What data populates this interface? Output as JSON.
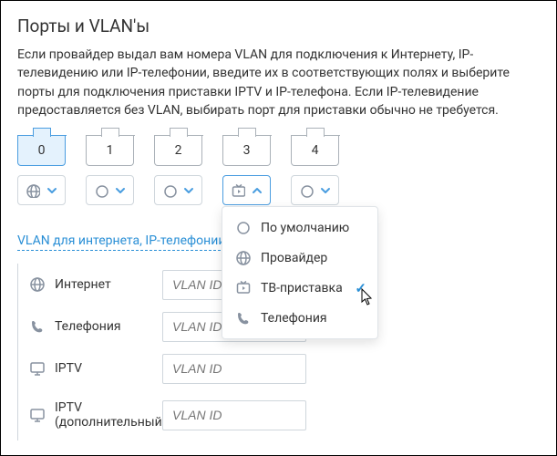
{
  "title": "Порты и VLAN'ы",
  "description": "Если провайдер выдал вам номера VLAN для подключения к Интернету, IP-телевидению или IP-телефонии, введите их в соответствующих полях и выберите порты для подключения приставки IPTV и IP-телефона. Если IP-телевидение предоставляется без VLAN, выбирать порт для приставки обычно не требуется.",
  "ports": [
    "0",
    "1",
    "2",
    "3",
    "4"
  ],
  "section_link": "VLAN для интернета, IP-телефонии и IPTV",
  "vlan": {
    "internet": {
      "label": "Интернет",
      "placeholder": "VLAN ID"
    },
    "telephony": {
      "label": "Телефония",
      "placeholder": "VLAN ID"
    },
    "iptv": {
      "label": "IPTV",
      "placeholder": "VLAN ID"
    },
    "iptv_extra": {
      "label": "IPTV (дополнительный)",
      "placeholder": "VLAN ID"
    }
  },
  "dropdown": {
    "default": "По умолчанию",
    "provider": "Провайдер",
    "tvbox": "ТВ-приставка",
    "telephony": "Телефония"
  }
}
